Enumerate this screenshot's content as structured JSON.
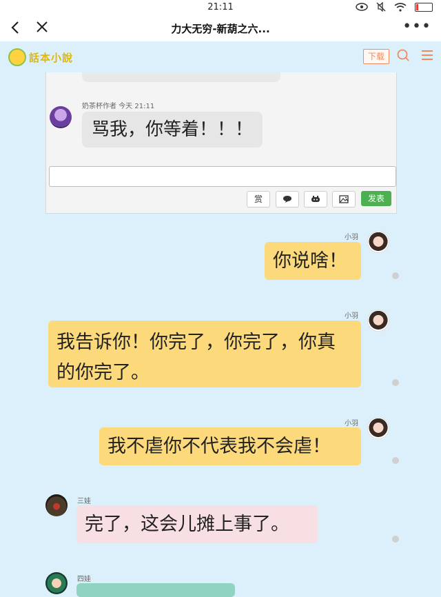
{
  "status_bar": {
    "time": "21:11"
  },
  "nav": {
    "title": "力大无穷-新葫之六..."
  },
  "site": {
    "logo_text": "話本小說",
    "download_label": "下载",
    "search_icon": "search-icon",
    "menu_icon": "menu-icon",
    "accent": "#f08a5d"
  },
  "comment_panel": {
    "author_meta": "奶茶杯作者 今天 21:11",
    "message": "骂我，你等着！！！",
    "input_value": "",
    "tools": {
      "reward_label": "赏",
      "publish_label": "发表"
    },
    "publish_color": "#4caf50"
  },
  "messages": [
    {
      "name": "小羽",
      "text": "你说啥！"
    },
    {
      "name": "小羽",
      "text": "我告诉你！你完了，你完了，你真的你完了。"
    },
    {
      "name": "小羽",
      "text": "我不虐你不代表我不会虐！"
    },
    {
      "name": "三娃",
      "text": "完了，这会儿摊上事了。"
    },
    {
      "name": "四娃",
      "text": ""
    }
  ]
}
